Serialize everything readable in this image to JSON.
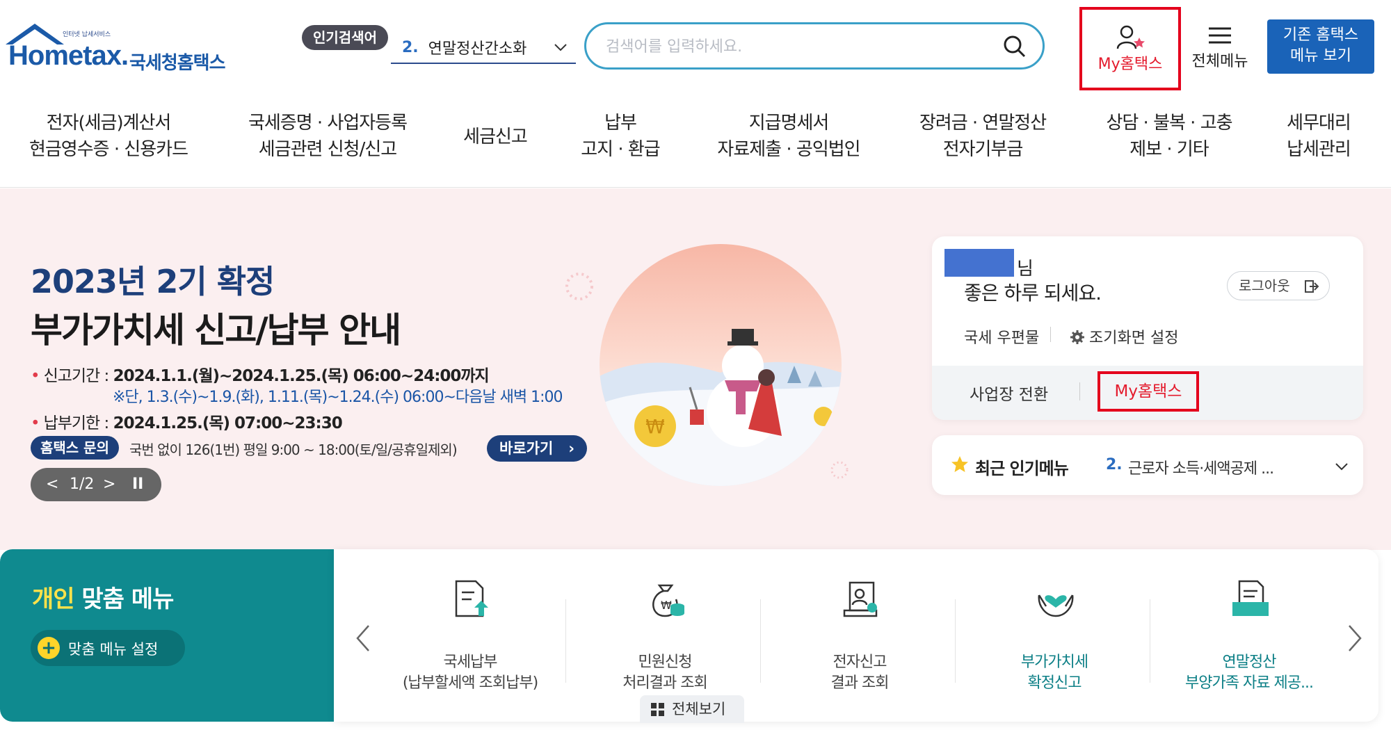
{
  "logo": {
    "tagline": "인터넷 납세서비스",
    "brand": "Hometax.",
    "korean": "국세청홈택스"
  },
  "popular_search": {
    "badge": "인기검색어",
    "rank": "2.",
    "keyword": "연말정산간소화"
  },
  "search": {
    "placeholder": "검색어를 입력하세요."
  },
  "header_links": {
    "my_hometax": "My홈택스",
    "all_menu": "전체메뉴",
    "classic_line1": "기존 홈택스",
    "classic_line2": "메뉴 보기"
  },
  "gnb": [
    {
      "l1": "전자(세금)계산서",
      "l2": "현금영수증 · 신용카드"
    },
    {
      "l1": "국세증명 · 사업자등록",
      "l2": "세금관련 신청/신고"
    },
    {
      "l1": "세금신고",
      "l2": ""
    },
    {
      "l1": "납부",
      "l2": "고지 · 환급"
    },
    {
      "l1": "지급명세서",
      "l2": "자료제출 · 공익법인"
    },
    {
      "l1": "장려금 · 연말정산",
      "l2": "전자기부금"
    },
    {
      "l1": "상담 · 불복 · 고충",
      "l2": "제보 · 기타"
    },
    {
      "l1": "세무대리",
      "l2": "납세관리"
    }
  ],
  "hero": {
    "title1": "2023년 2기 확정",
    "title2": "부가가치세 신고/납부 안내",
    "period_label": "신고기간 : ",
    "period_value": "2024.1.1.(월)~2024.1.25.(목) 06:00~24:00까지",
    "period_note": "※단, 1.3.(수)~1.9.(화), 1.11.(목)~1.24.(수) 06:00~다음날 새벽 1:00",
    "due_label": "납부기한 : ",
    "due_value": "2024.1.25.(목) 07:00~23:30",
    "inquiry_badge": "홈택스 문의",
    "inquiry_text": "국번 없이 126(1번) 평일 9:00 ~ 18:00(토/일/공휴일제외)",
    "goto": "바로가기",
    "pager": "1/2",
    "pager_prev": "<",
    "pager_next": ">",
    "pager_pause": "II"
  },
  "user_card": {
    "honorific": "님",
    "greeting": "좋은 하루 되세요.",
    "logout": "로그아웃",
    "mail": "국세 우편물",
    "init_screen": "조기화면 설정",
    "switch_biz": "사업장 전환",
    "my_hometax": "My홈택스"
  },
  "recent": {
    "label": "최근 인기메뉴",
    "rank": "2.",
    "text": "근로자 소득·세액공제 ..."
  },
  "personal_menu": {
    "title_accent": "개인",
    "title_rest": " 맞춤 메뉴",
    "setting": "맞춤 메뉴 설정",
    "view_all": "전체보기",
    "items": [
      {
        "l1": "국세납부",
        "l2": "(납부할세액 조회납부)",
        "icon": "tax-payment-icon",
        "highlight": false
      },
      {
        "l1": "민원신청",
        "l2": "처리결과 조회",
        "icon": "money-bag-icon",
        "highlight": false
      },
      {
        "l1": "전자신고",
        "l2": "결과 조회",
        "icon": "e-filing-icon",
        "highlight": false
      },
      {
        "l1": "부가가치세",
        "l2": "확정신고",
        "icon": "heart-hands-icon",
        "highlight": true
      },
      {
        "l1": "연말정산",
        "l2": "부양가족 자료 제공...",
        "icon": "document-tray-icon",
        "highlight": true
      }
    ]
  },
  "colors": {
    "brand_blue": "#1b5aa8",
    "accent_red": "#e4001c",
    "teal": "#0f8a8f",
    "hero_bg": "#fbeff0"
  }
}
